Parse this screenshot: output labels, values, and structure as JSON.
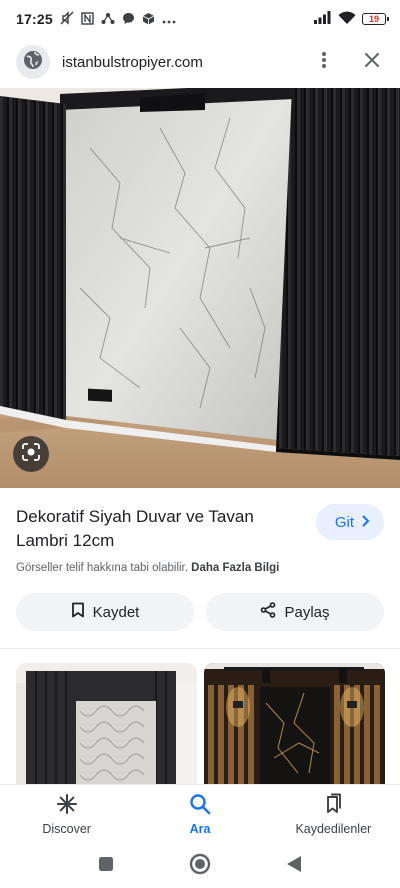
{
  "status_bar": {
    "time": "17:25",
    "notification_icons": [
      "mute-icon",
      "n-badge-icon",
      "share-network-icon",
      "chat-bubble-icon",
      "cube-icon",
      "more-dots-icon"
    ],
    "battery_level": "19",
    "battery_color": "#d93025"
  },
  "url_bar": {
    "domain": "istanbulstropiyer.com"
  },
  "result": {
    "title": "Dekoratif Siyah Duvar ve Tavan Lambri 12cm",
    "visit_label": "Git",
    "copyright_text": "Görseller telif hakkına tabi olabilir.",
    "more_info_label": "Daha Fazla Bilgi"
  },
  "actions": {
    "save_label": "Kaydet",
    "share_label": "Paylaş"
  },
  "bottom_nav": {
    "items": [
      {
        "label": "Discover",
        "icon": "asterisk-icon",
        "active": false
      },
      {
        "label": "Ara",
        "icon": "search-icon",
        "active": true
      },
      {
        "label": "Kaydedilenler",
        "icon": "bookmarks-icon",
        "active": false
      }
    ]
  },
  "colors": {
    "accent": "#1a73e8",
    "chip_background": "#e8f0fe",
    "button_background": "#f1f3f4"
  }
}
